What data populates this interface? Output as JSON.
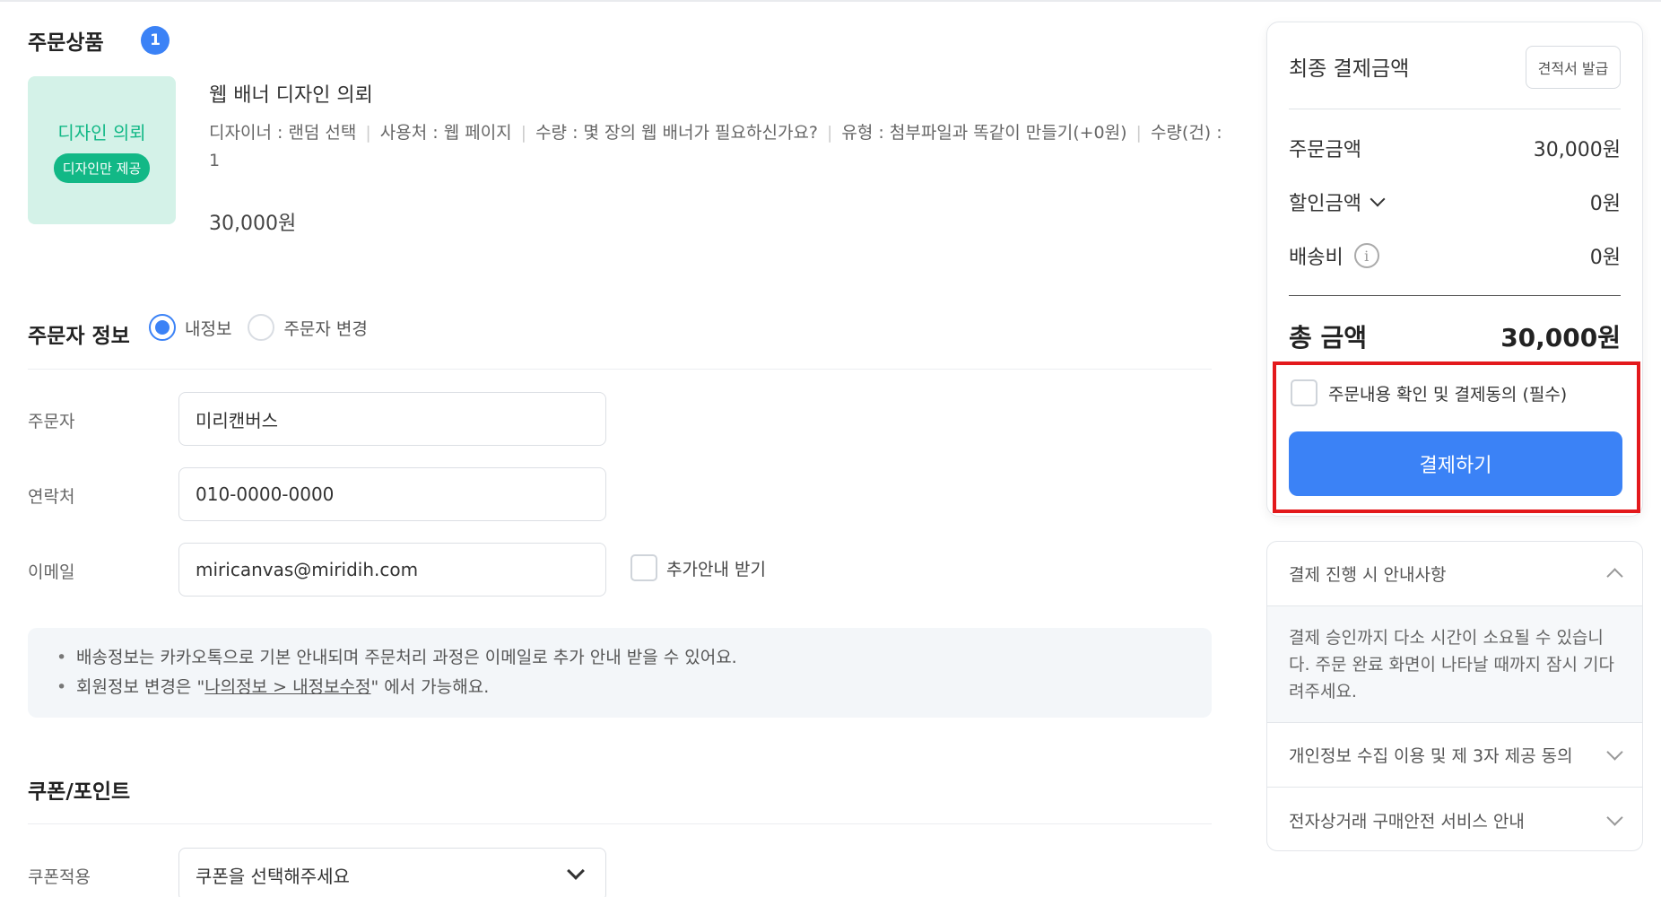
{
  "order_items": {
    "title": "주문상품",
    "count": "1",
    "product": {
      "thumb_title": "디자인 의뢰",
      "thumb_badge": "디자인만 제공",
      "name": "웹 배너 디자인 의뢰",
      "options": [
        "디자이너 : 랜덤 선택",
        "사용처 : 웹 페이지",
        "수량 : 몇 장의 웹 배너가 필요하신가요?",
        "유형 : 첨부파일과 똑같이 만들기(+0원)",
        "수량(건) : 1"
      ],
      "price": "30,000원"
    }
  },
  "orderer": {
    "title": "주문자 정보",
    "radio_mine": "내정보",
    "radio_change": "주문자 변경",
    "name_label": "주문자",
    "name_value": "미리캔버스",
    "phone_label": "연락처",
    "phone_value": "010-0000-0000",
    "email_label": "이메일",
    "email_value": "miricanvas@miridih.com",
    "extra_notice_label": "추가안내 받기",
    "notice_1": "배송정보는 카카오톡으로 기본 안내되며 주문처리 과정은 이메일로 추가 안내 받을 수 있어요.",
    "notice_2_prefix": "회원정보 변경은 \"",
    "notice_2_link": "나의정보 > 내정보수정",
    "notice_2_suffix": "\" 에서 가능해요."
  },
  "coupon": {
    "title": "쿠폰/포인트",
    "apply_label": "쿠폰적용",
    "select_placeholder": "쿠폰을 선택해주세요"
  },
  "summary": {
    "title": "최종 결제금액",
    "quote_button": "견적서 발급",
    "order_amount_label": "주문금액",
    "order_amount": "30,000원",
    "discount_label": "할인금액",
    "discount": "0원",
    "shipping_label": "배송비",
    "shipping": "0원",
    "total_label": "총 금액",
    "total": "30,000원",
    "agree_label": "주문내용 확인 및 결제동의 (필수)",
    "pay_button": "결제하기"
  },
  "info_accordion": {
    "item_1_title": "결제 진행 시 안내사항",
    "item_1_body": "결제 승인까지 다소 시간이 소요될 수 있습니다. 주문 완료 화면이 나타날 때까지 잠시 기다려주세요.",
    "item_2_title": "개인정보 수집 이용 및 제 3자 제공 동의",
    "item_3_title": "전자상거래 구매안전 서비스 안내"
  },
  "colors": {
    "accent": "#3b82f6",
    "mint": "#12b886",
    "highlight": "#e3191c"
  }
}
